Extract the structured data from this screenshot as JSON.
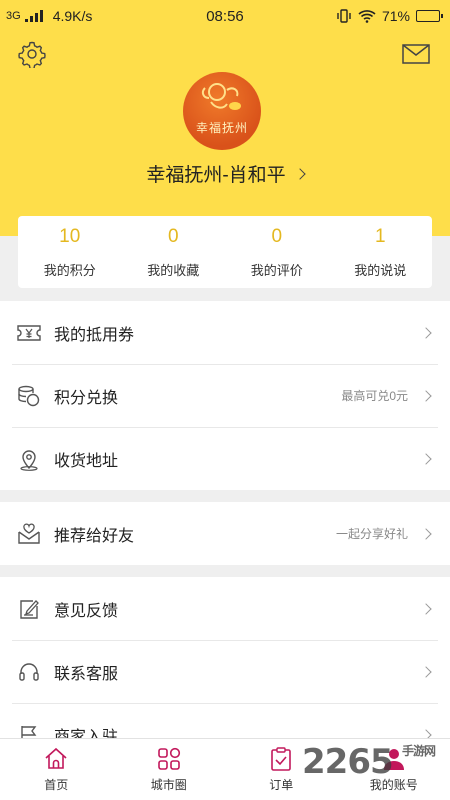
{
  "status_bar": {
    "network": "3G",
    "speed": "4.9K/s",
    "time": "08:56",
    "battery": "71%",
    "battery_level": 0.71
  },
  "profile": {
    "avatar_text": "幸福抚州",
    "username": "幸福抚州-肖和平"
  },
  "stats": [
    {
      "value": "10",
      "label": "我的积分"
    },
    {
      "value": "0",
      "label": "我的收藏"
    },
    {
      "value": "0",
      "label": "我的评价"
    },
    {
      "value": "1",
      "label": "我的说说"
    }
  ],
  "menu": {
    "voucher": {
      "label": "我的抵用券",
      "icon": "coupon-icon"
    },
    "points_exchange": {
      "label": "积分兑换",
      "hint": "最高可兑0元",
      "icon": "coins-icon"
    },
    "address": {
      "label": "收货地址",
      "icon": "location-pin-icon"
    },
    "recommend": {
      "label": "推荐给好友",
      "hint": "一起分享好礼",
      "icon": "envelope-heart-icon"
    },
    "feedback": {
      "label": "意见反馈",
      "icon": "edit-icon"
    },
    "customer_service": {
      "label": "联系客服",
      "icon": "headset-icon"
    },
    "merchant": {
      "label": "商家入驻",
      "icon": "flag-icon"
    }
  },
  "tabbar": [
    {
      "label": "首页",
      "icon": "home-icon"
    },
    {
      "label": "城市圈",
      "icon": "grid-icon"
    },
    {
      "label": "订单",
      "icon": "clipboard-check-icon"
    },
    {
      "label": "我的账号",
      "icon": "user-icon"
    }
  ],
  "watermark": {
    "number": "2265",
    "site": "手游网"
  },
  "colors": {
    "accent_yellow": "#fede4a",
    "stat_number": "#e4b820",
    "tab_active": "#c2185b"
  }
}
